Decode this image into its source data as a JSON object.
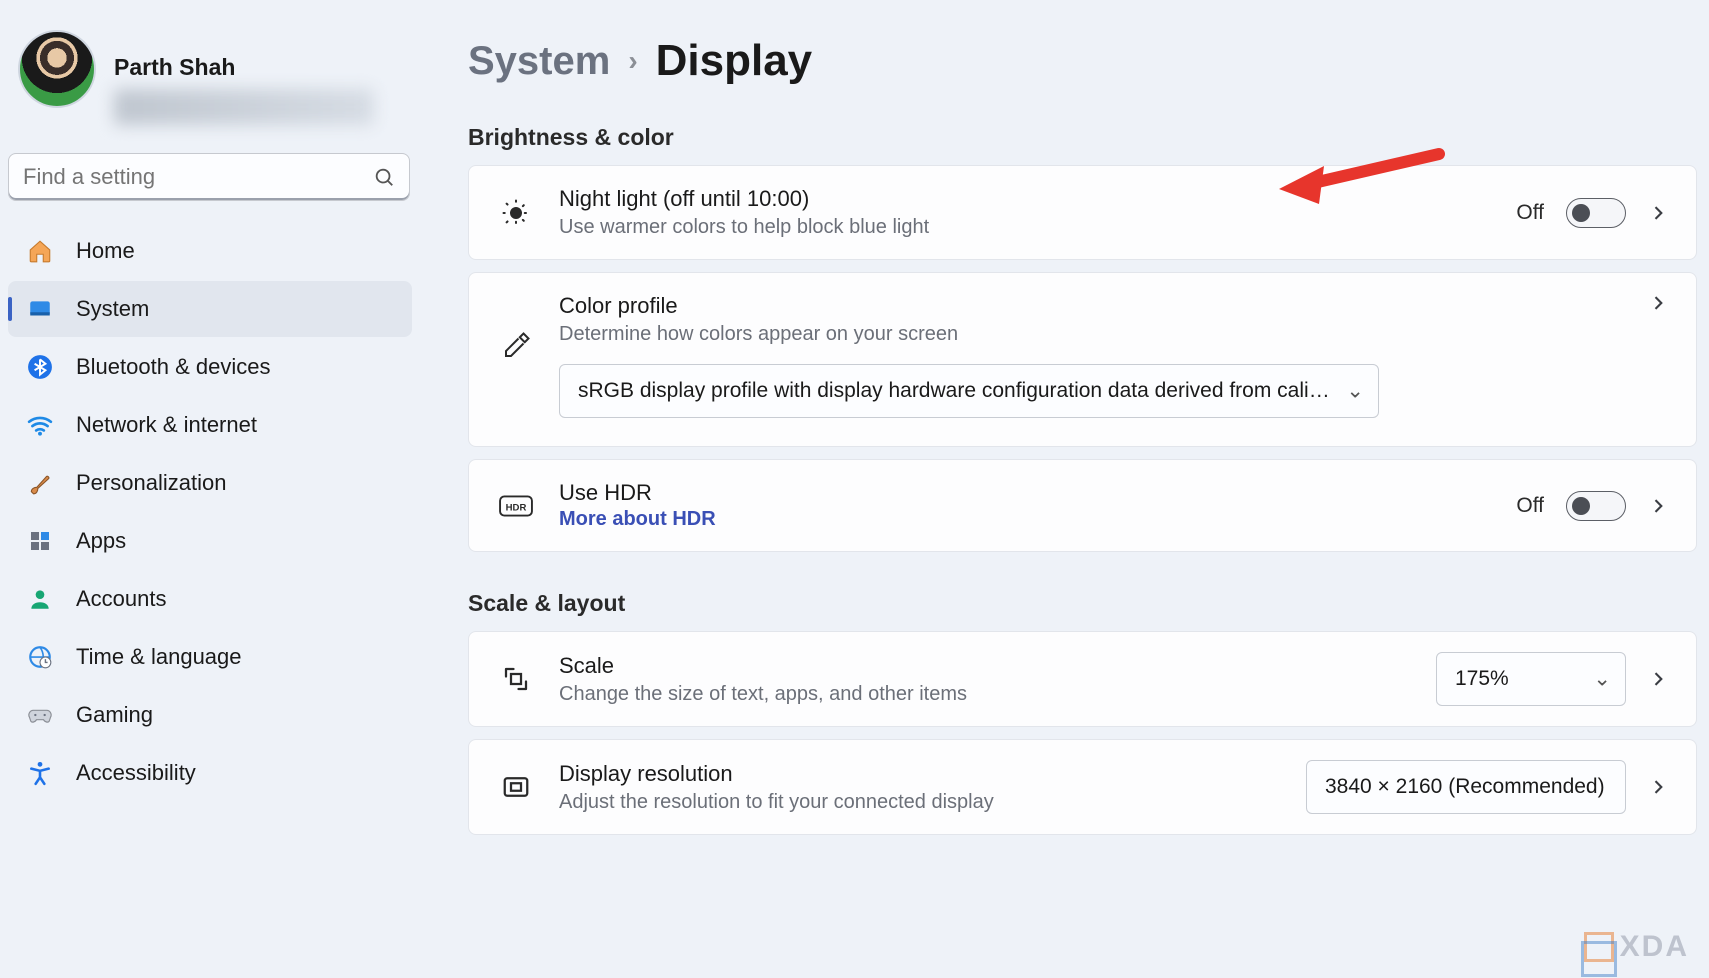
{
  "profile": {
    "name": "Parth Shah"
  },
  "search": {
    "placeholder": "Find a setting"
  },
  "nav": {
    "home": "Home",
    "system": "System",
    "bluetooth": "Bluetooth & devices",
    "network": "Network & internet",
    "personalization": "Personalization",
    "apps": "Apps",
    "accounts": "Accounts",
    "time": "Time & language",
    "gaming": "Gaming",
    "accessibility": "Accessibility"
  },
  "breadcrumb": {
    "parent": "System",
    "current": "Display"
  },
  "sections": {
    "brightness": "Brightness & color",
    "scale": "Scale & layout"
  },
  "night_light": {
    "title": "Night light (off until 10:00)",
    "subtitle": "Use warmer colors to help block blue light",
    "state": "Off"
  },
  "color_profile": {
    "title": "Color profile",
    "subtitle": "Determine how colors appear on your screen",
    "selected": "sRGB display profile with display hardware configuration data derived from calibrati"
  },
  "hdr": {
    "title": "Use HDR",
    "link": "More about HDR",
    "state": "Off"
  },
  "scale_row": {
    "title": "Scale",
    "subtitle": "Change the size of text, apps, and other items",
    "value": "175%"
  },
  "resolution": {
    "title": "Display resolution",
    "subtitle": "Adjust the resolution to fit your connected display",
    "value": "3840 × 2160 (Recommended)"
  },
  "watermark": "XDA"
}
